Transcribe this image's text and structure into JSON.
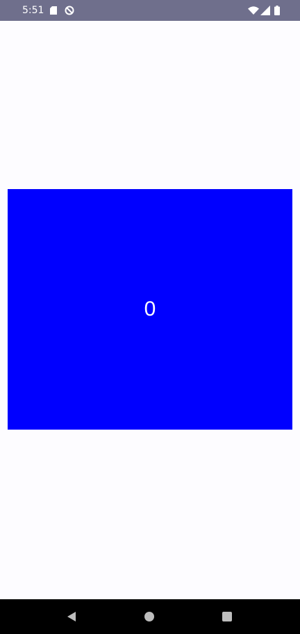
{
  "status_bar": {
    "time": "5:51",
    "icons": [
      "sd-card-icon",
      "do-not-disturb-icon",
      "wifi-icon",
      "signal-icon",
      "battery-icon"
    ]
  },
  "counter": {
    "value": "0",
    "background_color": "#0000ff",
    "text_color": "#ffffff"
  },
  "nav_bar": {
    "icons": [
      "back-icon",
      "home-icon",
      "recents-icon"
    ]
  }
}
